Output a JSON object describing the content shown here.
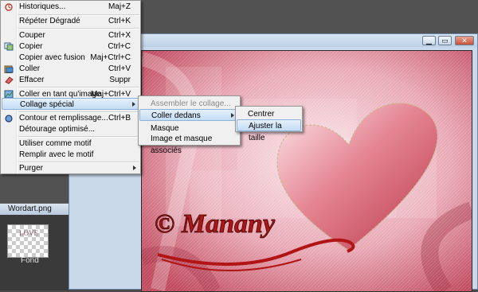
{
  "menu": {
    "items": [
      {
        "label": "Historiques...",
        "shortcut": "Maj+Z",
        "icon": "history-icon"
      },
      {
        "label": "Répéter Dégradé",
        "shortcut": "Ctrl+K"
      },
      {
        "label": "Couper",
        "shortcut": "Ctrl+X"
      },
      {
        "label": "Copier",
        "shortcut": "Ctrl+C",
        "icon": "copy-icon"
      },
      {
        "label": "Copier avec fusion",
        "shortcut": "Maj+Ctrl+C"
      },
      {
        "label": "Coller",
        "shortcut": "Ctrl+V",
        "icon": "paste-icon"
      },
      {
        "label": "Effacer",
        "shortcut": "Suppr",
        "icon": "eraser-icon"
      },
      {
        "label": "Coller en tant qu'image",
        "shortcut": "Maj+Ctrl+V",
        "icon": "paste-as-image-icon"
      },
      {
        "label": "Collage spécial",
        "shortcut": ""
      },
      {
        "label": "Contour et remplissage...",
        "shortcut": "Ctrl+B",
        "icon": "stroke-fill-icon"
      },
      {
        "label": "Détourage optimisé...",
        "shortcut": ""
      },
      {
        "label": "Utiliser comme motif",
        "shortcut": ""
      },
      {
        "label": "Remplir avec le motif",
        "shortcut": ""
      },
      {
        "label": "Purger",
        "shortcut": ""
      }
    ]
  },
  "submenu1": {
    "items": [
      {
        "label": "Assembler le collage..."
      },
      {
        "label": "Coller dedans"
      },
      {
        "label": "Masque"
      },
      {
        "label": "Image et masque associés"
      }
    ]
  },
  "submenu2": {
    "items": [
      {
        "label": "Centrer"
      },
      {
        "label": "Ajuster la taille"
      }
    ]
  },
  "image_window": {
    "minimize": "▁",
    "maximize": "▭",
    "close": "✕"
  },
  "canvas": {
    "watermark": "© Manany"
  },
  "layers_panel": {
    "title": "Wordart.png",
    "thumb_text": "LOVE",
    "layer_name": "Fond"
  },
  "colors": {
    "menu_bg": "#f0f0f0",
    "highlight": "#c4dcf4",
    "heart": "#d9606f",
    "watermark": "#b01414"
  }
}
